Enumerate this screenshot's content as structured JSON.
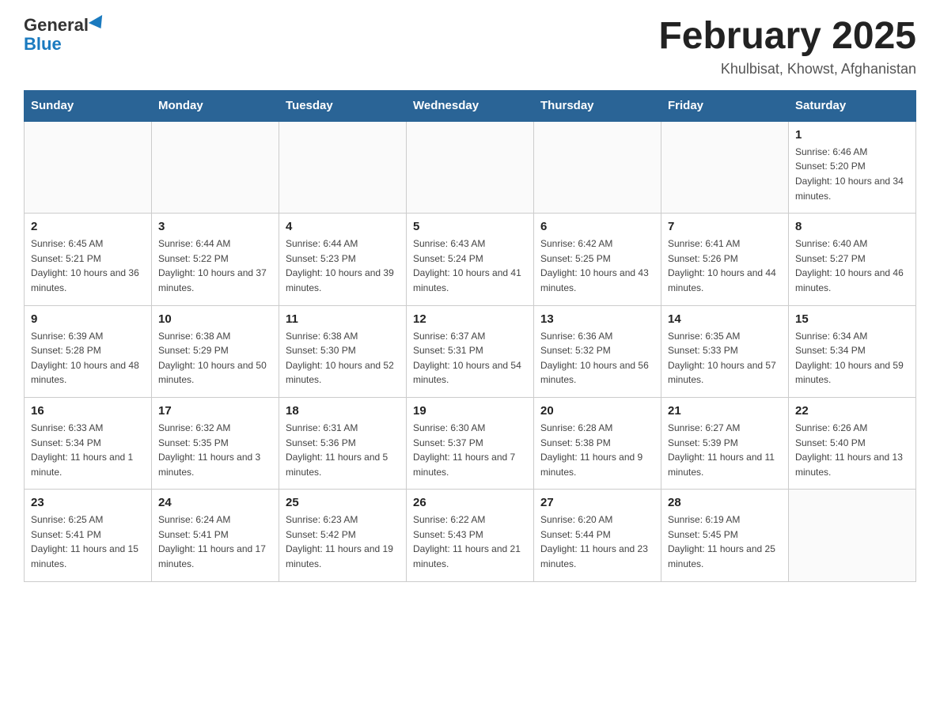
{
  "header": {
    "logo_general": "General",
    "logo_blue": "Blue",
    "month_title": "February 2025",
    "location": "Khulbisat, Khowst, Afghanistan"
  },
  "days_of_week": [
    "Sunday",
    "Monday",
    "Tuesday",
    "Wednesday",
    "Thursday",
    "Friday",
    "Saturday"
  ],
  "weeks": [
    [
      {
        "day": "",
        "info": ""
      },
      {
        "day": "",
        "info": ""
      },
      {
        "day": "",
        "info": ""
      },
      {
        "day": "",
        "info": ""
      },
      {
        "day": "",
        "info": ""
      },
      {
        "day": "",
        "info": ""
      },
      {
        "day": "1",
        "info": "Sunrise: 6:46 AM\nSunset: 5:20 PM\nDaylight: 10 hours and 34 minutes."
      }
    ],
    [
      {
        "day": "2",
        "info": "Sunrise: 6:45 AM\nSunset: 5:21 PM\nDaylight: 10 hours and 36 minutes."
      },
      {
        "day": "3",
        "info": "Sunrise: 6:44 AM\nSunset: 5:22 PM\nDaylight: 10 hours and 37 minutes."
      },
      {
        "day": "4",
        "info": "Sunrise: 6:44 AM\nSunset: 5:23 PM\nDaylight: 10 hours and 39 minutes."
      },
      {
        "day": "5",
        "info": "Sunrise: 6:43 AM\nSunset: 5:24 PM\nDaylight: 10 hours and 41 minutes."
      },
      {
        "day": "6",
        "info": "Sunrise: 6:42 AM\nSunset: 5:25 PM\nDaylight: 10 hours and 43 minutes."
      },
      {
        "day": "7",
        "info": "Sunrise: 6:41 AM\nSunset: 5:26 PM\nDaylight: 10 hours and 44 minutes."
      },
      {
        "day": "8",
        "info": "Sunrise: 6:40 AM\nSunset: 5:27 PM\nDaylight: 10 hours and 46 minutes."
      }
    ],
    [
      {
        "day": "9",
        "info": "Sunrise: 6:39 AM\nSunset: 5:28 PM\nDaylight: 10 hours and 48 minutes."
      },
      {
        "day": "10",
        "info": "Sunrise: 6:38 AM\nSunset: 5:29 PM\nDaylight: 10 hours and 50 minutes."
      },
      {
        "day": "11",
        "info": "Sunrise: 6:38 AM\nSunset: 5:30 PM\nDaylight: 10 hours and 52 minutes."
      },
      {
        "day": "12",
        "info": "Sunrise: 6:37 AM\nSunset: 5:31 PM\nDaylight: 10 hours and 54 minutes."
      },
      {
        "day": "13",
        "info": "Sunrise: 6:36 AM\nSunset: 5:32 PM\nDaylight: 10 hours and 56 minutes."
      },
      {
        "day": "14",
        "info": "Sunrise: 6:35 AM\nSunset: 5:33 PM\nDaylight: 10 hours and 57 minutes."
      },
      {
        "day": "15",
        "info": "Sunrise: 6:34 AM\nSunset: 5:34 PM\nDaylight: 10 hours and 59 minutes."
      }
    ],
    [
      {
        "day": "16",
        "info": "Sunrise: 6:33 AM\nSunset: 5:34 PM\nDaylight: 11 hours and 1 minute."
      },
      {
        "day": "17",
        "info": "Sunrise: 6:32 AM\nSunset: 5:35 PM\nDaylight: 11 hours and 3 minutes."
      },
      {
        "day": "18",
        "info": "Sunrise: 6:31 AM\nSunset: 5:36 PM\nDaylight: 11 hours and 5 minutes."
      },
      {
        "day": "19",
        "info": "Sunrise: 6:30 AM\nSunset: 5:37 PM\nDaylight: 11 hours and 7 minutes."
      },
      {
        "day": "20",
        "info": "Sunrise: 6:28 AM\nSunset: 5:38 PM\nDaylight: 11 hours and 9 minutes."
      },
      {
        "day": "21",
        "info": "Sunrise: 6:27 AM\nSunset: 5:39 PM\nDaylight: 11 hours and 11 minutes."
      },
      {
        "day": "22",
        "info": "Sunrise: 6:26 AM\nSunset: 5:40 PM\nDaylight: 11 hours and 13 minutes."
      }
    ],
    [
      {
        "day": "23",
        "info": "Sunrise: 6:25 AM\nSunset: 5:41 PM\nDaylight: 11 hours and 15 minutes."
      },
      {
        "day": "24",
        "info": "Sunrise: 6:24 AM\nSunset: 5:41 PM\nDaylight: 11 hours and 17 minutes."
      },
      {
        "day": "25",
        "info": "Sunrise: 6:23 AM\nSunset: 5:42 PM\nDaylight: 11 hours and 19 minutes."
      },
      {
        "day": "26",
        "info": "Sunrise: 6:22 AM\nSunset: 5:43 PM\nDaylight: 11 hours and 21 minutes."
      },
      {
        "day": "27",
        "info": "Sunrise: 6:20 AM\nSunset: 5:44 PM\nDaylight: 11 hours and 23 minutes."
      },
      {
        "day": "28",
        "info": "Sunrise: 6:19 AM\nSunset: 5:45 PM\nDaylight: 11 hours and 25 minutes."
      },
      {
        "day": "",
        "info": ""
      }
    ]
  ]
}
